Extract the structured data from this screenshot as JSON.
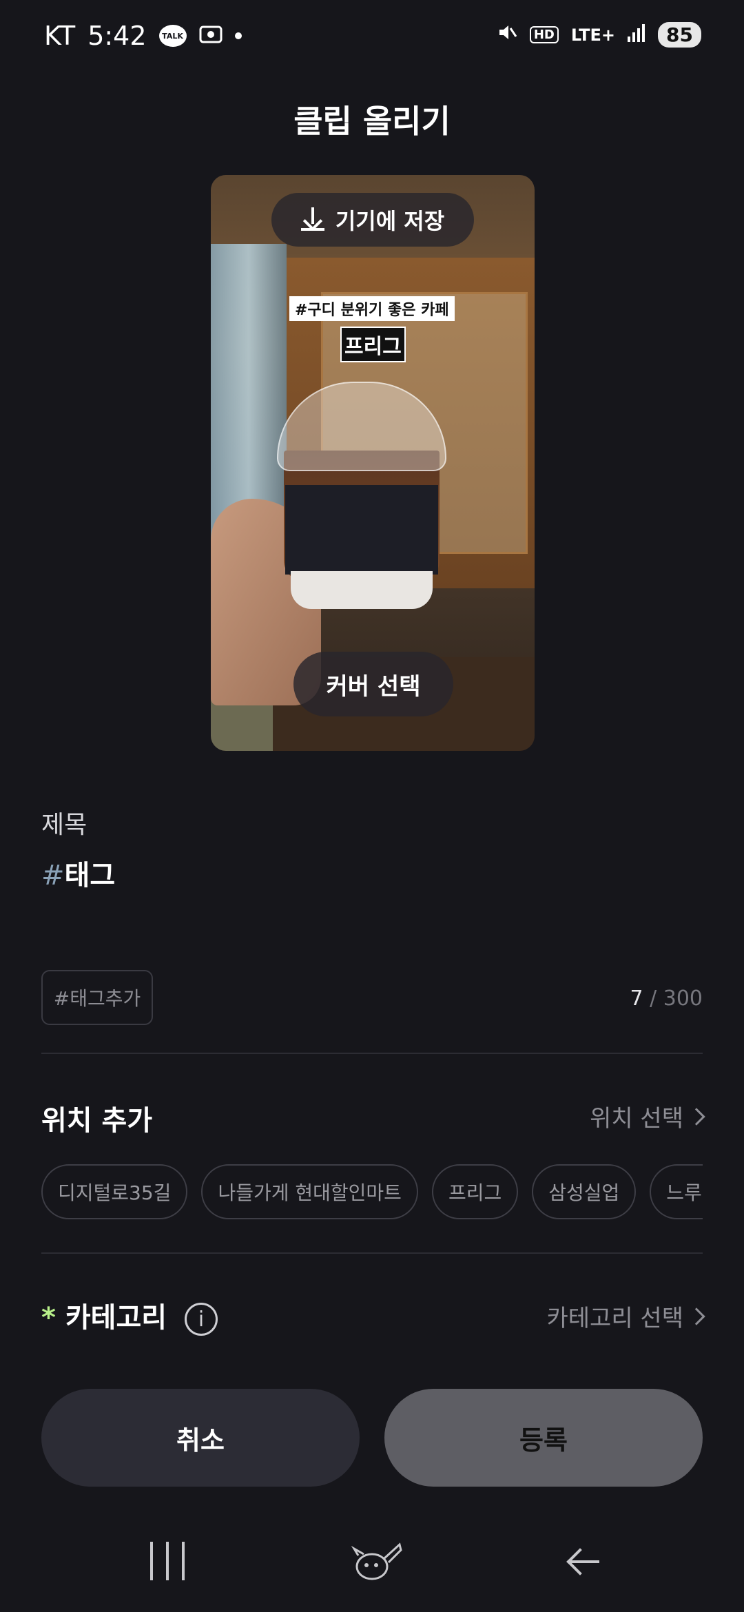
{
  "status_bar": {
    "carrier": "KT",
    "time": "5:42",
    "talk_icon_label": "TALK",
    "network": "LTE+",
    "hd": "HD",
    "battery": "85"
  },
  "page_title": "클립 올리기",
  "preview": {
    "save_label": "기기에 저장",
    "sticker_tag": "#구디 분위기 좋은 카페",
    "sticker_name": "프리그",
    "cover_label": "커버 선택"
  },
  "form": {
    "title_label": "제목",
    "tag_hash": "#",
    "tag_value": "태그",
    "add_tag_label": "#태그추가",
    "count_current": "7",
    "count_max": " / 300"
  },
  "location": {
    "title": "위치 추가",
    "action_label": "위치 선택",
    "chips": [
      "디지털로35길",
      "나들가게 현대할인마트",
      "프리그",
      "삼성실업",
      "느루요"
    ]
  },
  "category": {
    "required_mark": "*",
    "title": "카테고리",
    "info": "i",
    "action_label": "카테고리 선택"
  },
  "buttons": {
    "cancel": "취소",
    "register": "등록"
  },
  "colors": {
    "background": "#16161b",
    "accent_required": "#b8f08a",
    "register_button": "#5e5e64"
  },
  "icons": [
    "talk-icon",
    "download-icon",
    "chevron-right-icon",
    "info-icon",
    "recent-apps-icon",
    "home-icon",
    "back-icon"
  ]
}
